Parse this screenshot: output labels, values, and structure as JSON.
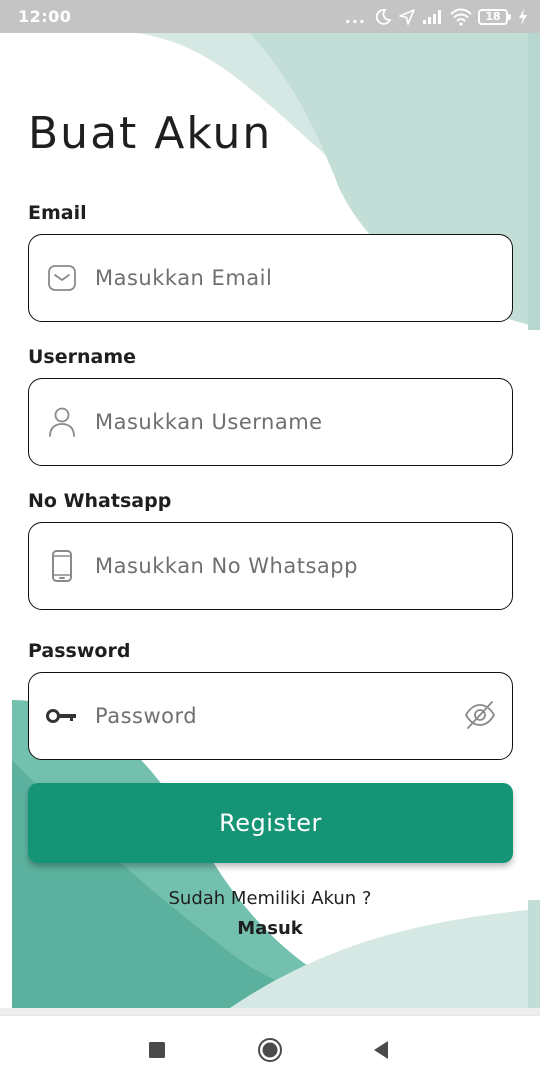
{
  "status_bar": {
    "time": "12:00",
    "more": "...",
    "battery_level": "18",
    "icons": [
      "moon-icon",
      "location-arrow-icon",
      "signal-icon",
      "wifi-icon",
      "battery-icon",
      "charging-bolt-icon"
    ]
  },
  "page": {
    "title": "Buat Akun"
  },
  "form": {
    "email": {
      "label": "Email",
      "placeholder": "Masukkan Email",
      "icon": "envelope-icon"
    },
    "username": {
      "label": "Username",
      "placeholder": "Masukkan Username",
      "icon": "user-icon"
    },
    "whatsapp": {
      "label": "No Whatsapp",
      "placeholder": "Masukkan No Whatsapp",
      "icon": "phone-icon"
    },
    "password": {
      "label": "Password",
      "placeholder": "Password",
      "icon": "key-icon",
      "toggle_icon": "eye-off-icon"
    },
    "register_label": "Register"
  },
  "footer": {
    "prompt": "Sudah Memiliki Akun ?",
    "login_label": "Masuk"
  },
  "nav": {
    "icons": [
      "recents-square-icon",
      "home-circle-icon",
      "back-triangle-icon"
    ]
  },
  "colors": {
    "primary": "#159575",
    "shape_light": "#d9eae6",
    "shape_mid": "#c1dcd6",
    "shape_green": "#73c0ae",
    "shape_dark": "#5db29f"
  }
}
